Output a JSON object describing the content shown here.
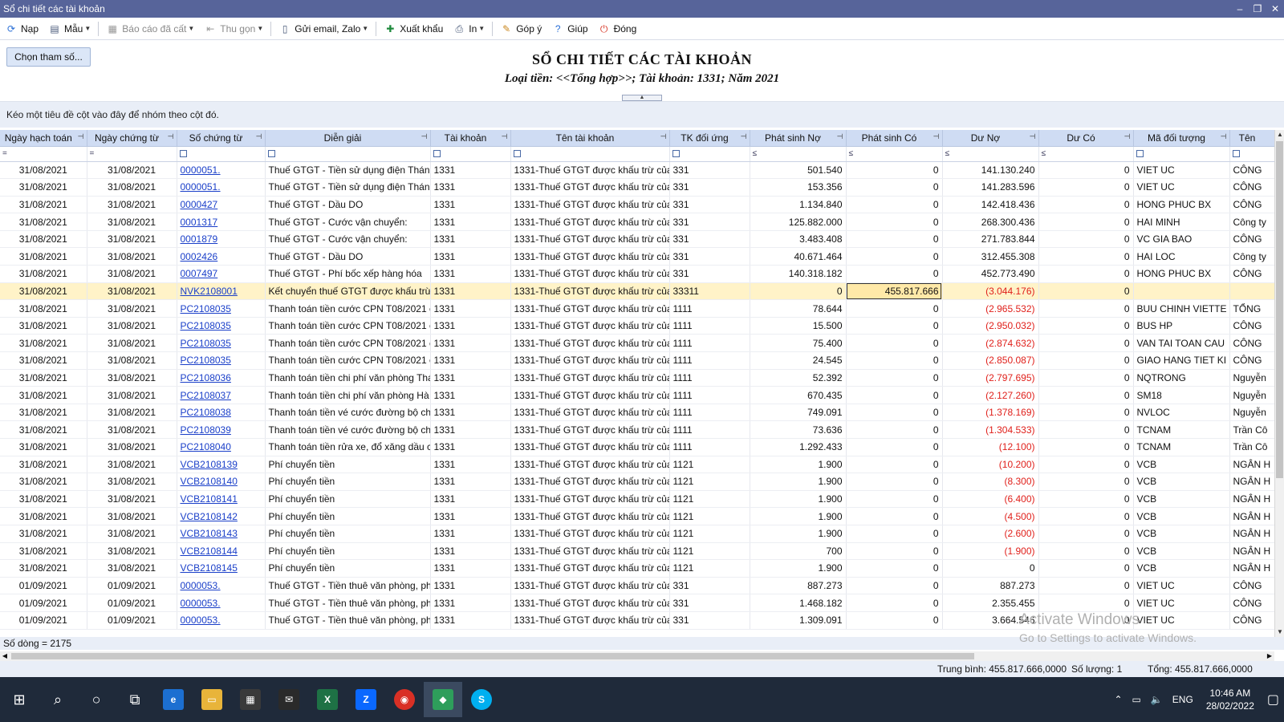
{
  "window": {
    "title": "Sổ chi tiết các tài khoản"
  },
  "toolbar": [
    {
      "label": "Nạp",
      "icon": "reload-icon",
      "dropdown": false,
      "disabled": false
    },
    {
      "label": "Mẫu",
      "icon": "template-icon",
      "dropdown": true,
      "disabled": false
    },
    {
      "label": "Báo cáo đã cất",
      "icon": "save-icon",
      "dropdown": true,
      "disabled": true
    },
    {
      "label": "Thu gọn",
      "icon": "collapse-icon",
      "dropdown": true,
      "disabled": true
    },
    {
      "label": "Gửi email, Zalo",
      "icon": "document-icon",
      "dropdown": true,
      "disabled": false
    },
    {
      "label": "Xuất khẩu",
      "icon": "excel-icon",
      "dropdown": false,
      "disabled": false
    },
    {
      "label": "In",
      "icon": "printer-icon",
      "dropdown": true,
      "disabled": false
    },
    {
      "label": "Góp ý",
      "icon": "feedback-icon",
      "dropdown": false,
      "disabled": false
    },
    {
      "label": "Giúp",
      "icon": "help-icon",
      "dropdown": false,
      "disabled": false
    },
    {
      "label": "Đóng",
      "icon": "power-icon",
      "dropdown": false,
      "disabled": false
    }
  ],
  "params_button": "Chọn tham số...",
  "report": {
    "title": "SỔ CHI TIẾT CÁC TÀI KHOẢN",
    "subtitle": "Loại tiền: <<Tổng hợp>>; Tài khoản: 1331; Năm 2021"
  },
  "group_hint": "Kéo một tiêu đề cột vào đây để nhóm theo cột đó.",
  "columns": [
    "Ngày hạch toán",
    "Ngày chứng từ",
    "Số chứng từ",
    "Diễn giải",
    "Tài khoản",
    "Tên tài khoản",
    "TK đối ứng",
    "Phát sinh Nợ",
    "Phát sinh Có",
    "Dư Nợ",
    "Dư Có",
    "Mã đối tượng",
    "Tên"
  ],
  "filters": [
    "=",
    "=",
    "□",
    "□",
    "□",
    "□",
    "□",
    "≤",
    "≤",
    "≤",
    "≤",
    "□",
    "□"
  ],
  "rows": [
    [
      "31/08/2021",
      "31/08/2021",
      "0000051.",
      "Thuế GTGT - Tiền sử dụng điện Tháng",
      "1331",
      "1331-Thuế GTGT được khấu trừ của h",
      "331",
      "501.540",
      "0",
      "141.130.240",
      "0",
      "VIET UC",
      "CÔNG"
    ],
    [
      "31/08/2021",
      "31/08/2021",
      "0000051.",
      "Thuế GTGT - Tiền sử dụng điện Tháng",
      "1331",
      "1331-Thuế GTGT được khấu trừ của h",
      "331",
      "153.356",
      "0",
      "141.283.596",
      "0",
      "VIET UC",
      "CÔNG"
    ],
    [
      "31/08/2021",
      "31/08/2021",
      "0000427",
      "Thuế GTGT - Dầu DO",
      "1331",
      "1331-Thuế GTGT được khấu trừ của h",
      "331",
      "1.134.840",
      "0",
      "142.418.436",
      "0",
      "HONG PHUC BX",
      "CÔNG"
    ],
    [
      "31/08/2021",
      "31/08/2021",
      "0001317",
      "Thuế GTGT - Cước vận chuyển:",
      "1331",
      "1331-Thuế GTGT được khấu trừ của h",
      "331",
      "125.882.000",
      "0",
      "268.300.436",
      "0",
      "HAI MINH",
      "Công ty"
    ],
    [
      "31/08/2021",
      "31/08/2021",
      "0001879",
      "Thuế GTGT - Cước vận chuyển:",
      "1331",
      "1331-Thuế GTGT được khấu trừ của h",
      "331",
      "3.483.408",
      "0",
      "271.783.844",
      "0",
      "VC GIA BAO",
      "CÔNG"
    ],
    [
      "31/08/2021",
      "31/08/2021",
      "0002426",
      "Thuế GTGT - Dầu DO",
      "1331",
      "1331-Thuế GTGT được khấu trừ của h",
      "331",
      "40.671.464",
      "0",
      "312.455.308",
      "0",
      "HAI LOC",
      "Công ty"
    ],
    [
      "31/08/2021",
      "31/08/2021",
      "0007497",
      "Thuế GTGT - Phí bốc xếp hàng hóa",
      "1331",
      "1331-Thuế GTGT được khấu trừ của h",
      "331",
      "140.318.182",
      "0",
      "452.773.490",
      "0",
      "HONG PHUC BX",
      "CÔNG"
    ],
    [
      "31/08/2021",
      "31/08/2021",
      "NVK2108001",
      "Kết chuyển thuế GTGT được khấu trừ T",
      "1331",
      "1331-Thuế GTGT được khấu trừ của h",
      "33311",
      "0",
      "455.817.666",
      "(3.044.176)",
      "0",
      "",
      ""
    ],
    [
      "31/08/2021",
      "31/08/2021",
      "PC2108035",
      "Thanh toán tiền cước CPN T08/2021 ch",
      "1331",
      "1331-Thuế GTGT được khấu trừ của h",
      "1111",
      "78.644",
      "0",
      "(2.965.532)",
      "0",
      "BUU CHINH VIETTE",
      "TỔNG"
    ],
    [
      "31/08/2021",
      "31/08/2021",
      "PC2108035",
      "Thanh toán tiền cước CPN T08/2021 ch",
      "1331",
      "1331-Thuế GTGT được khấu trừ của h",
      "1111",
      "15.500",
      "0",
      "(2.950.032)",
      "0",
      "BUS HP",
      "CÔNG"
    ],
    [
      "31/08/2021",
      "31/08/2021",
      "PC2108035",
      "Thanh toán tiền cước CPN T08/2021 ch",
      "1331",
      "1331-Thuế GTGT được khấu trừ của h",
      "1111",
      "75.400",
      "0",
      "(2.874.632)",
      "0",
      "VAN TAI TOAN CAU",
      "CÔNG"
    ],
    [
      "31/08/2021",
      "31/08/2021",
      "PC2108035",
      "Thanh toán tiền cước CPN T08/2021 ch",
      "1331",
      "1331-Thuế GTGT được khấu trừ của h",
      "1111",
      "24.545",
      "0",
      "(2.850.087)",
      "0",
      "GIAO HANG TIET KI",
      "CÔNG"
    ],
    [
      "31/08/2021",
      "31/08/2021",
      "PC2108036",
      "Thanh toán tiền chi phí văn phòng Thái",
      "1331",
      "1331-Thuế GTGT được khấu trừ của h",
      "1111",
      "52.392",
      "0",
      "(2.797.695)",
      "0",
      "NQTRONG",
      "Nguyễn"
    ],
    [
      "31/08/2021",
      "31/08/2021",
      "PC2108037",
      "Thanh toán tiền chi phí văn phòng Hà N",
      "1331",
      "1331-Thuế GTGT được khấu trừ của h",
      "1111",
      "670.435",
      "0",
      "(2.127.260)",
      "0",
      "SM18",
      "Nguyễn"
    ],
    [
      "31/08/2021",
      "31/08/2021",
      "PC2108038",
      "Thanh toán tiền vé cước đường bộ cho x",
      "1331",
      "1331-Thuế GTGT được khấu trừ của h",
      "1111",
      "749.091",
      "0",
      "(1.378.169)",
      "0",
      "NVLOC",
      "Nguyễn"
    ],
    [
      "31/08/2021",
      "31/08/2021",
      "PC2108039",
      "Thanh toán tiền vé cước đường bộ cho x",
      "1331",
      "1331-Thuế GTGT được khấu trừ của h",
      "1111",
      "73.636",
      "0",
      "(1.304.533)",
      "0",
      "TCNAM",
      "Trần Cô"
    ],
    [
      "31/08/2021",
      "31/08/2021",
      "PC2108040",
      "Thanh toán tiền rửa xe, đổ xăng dầu ch",
      "1331",
      "1331-Thuế GTGT được khấu trừ của h",
      "1111",
      "1.292.433",
      "0",
      "(12.100)",
      "0",
      "TCNAM",
      "Trần Cô"
    ],
    [
      "31/08/2021",
      "31/08/2021",
      "VCB2108139",
      "Phí chuyển tiền",
      "1331",
      "1331-Thuế GTGT được khấu trừ của h",
      "1121",
      "1.900",
      "0",
      "(10.200)",
      "0",
      "VCB",
      "NGÂN H"
    ],
    [
      "31/08/2021",
      "31/08/2021",
      "VCB2108140",
      "Phí chuyển tiền",
      "1331",
      "1331-Thuế GTGT được khấu trừ của h",
      "1121",
      "1.900",
      "0",
      "(8.300)",
      "0",
      "VCB",
      "NGÂN H"
    ],
    [
      "31/08/2021",
      "31/08/2021",
      "VCB2108141",
      "Phí chuyển tiền",
      "1331",
      "1331-Thuế GTGT được khấu trừ của h",
      "1121",
      "1.900",
      "0",
      "(6.400)",
      "0",
      "VCB",
      "NGÂN H"
    ],
    [
      "31/08/2021",
      "31/08/2021",
      "VCB2108142",
      "Phí chuyển tiền",
      "1331",
      "1331-Thuế GTGT được khấu trừ của h",
      "1121",
      "1.900",
      "0",
      "(4.500)",
      "0",
      "VCB",
      "NGÂN H"
    ],
    [
      "31/08/2021",
      "31/08/2021",
      "VCB2108143",
      "Phí chuyển tiền",
      "1331",
      "1331-Thuế GTGT được khấu trừ của h",
      "1121",
      "1.900",
      "0",
      "(2.600)",
      "0",
      "VCB",
      "NGÂN H"
    ],
    [
      "31/08/2021",
      "31/08/2021",
      "VCB2108144",
      "Phí chuyển tiền",
      "1331",
      "1331-Thuế GTGT được khấu trừ của h",
      "1121",
      "700",
      "0",
      "(1.900)",
      "0",
      "VCB",
      "NGÂN H"
    ],
    [
      "31/08/2021",
      "31/08/2021",
      "VCB2108145",
      "Phí chuyển tiền",
      "1331",
      "1331-Thuế GTGT được khấu trừ của h",
      "1121",
      "1.900",
      "0",
      "0",
      "0",
      "VCB",
      "NGÂN H"
    ],
    [
      "01/09/2021",
      "01/09/2021",
      "0000053.",
      "Thuế GTGT - Tiền thuê văn phòng, phí",
      "1331",
      "1331-Thuế GTGT được khấu trừ của h",
      "331",
      "887.273",
      "0",
      "887.273",
      "0",
      "VIET UC",
      "CÔNG"
    ],
    [
      "01/09/2021",
      "01/09/2021",
      "0000053.",
      "Thuế GTGT - Tiền thuê văn phòng, phí",
      "1331",
      "1331-Thuế GTGT được khấu trừ của h",
      "331",
      "1.468.182",
      "0",
      "2.355.455",
      "0",
      "VIET UC",
      "CÔNG"
    ],
    [
      "01/09/2021",
      "01/09/2021",
      "0000053.",
      "Thuế GTGT - Tiền thuê văn phòng, phí",
      "1331",
      "1331-Thuế GTGT được khấu trừ của h",
      "331",
      "1.309.091",
      "0",
      "3.664.546",
      "0",
      "VIET UC",
      "CÔNG"
    ]
  ],
  "selected_row": 7,
  "row_count": "Số dòng = 2175",
  "summary": {
    "average": "Trung bình: 455.817.666,0000",
    "count": "Số lượng: 1",
    "total": "Tổng: 455.817.666,0000"
  },
  "watermark": {
    "line1": "Activate Windows",
    "line2": "Go to Settings to activate Windows."
  },
  "taskbar": {
    "apps": [
      "start-icon",
      "search-icon",
      "cortana-icon",
      "task-view-icon",
      "edge-icon",
      "explorer-icon",
      "store-icon",
      "mail-icon",
      "excel-icon",
      "zalo-icon",
      "chrome-icon",
      "misa-icon",
      "skype-icon"
    ],
    "language": "ENG",
    "time": "10:46 AM",
    "date": "28/02/2022"
  },
  "colors": {
    "titlebar": "#57649a",
    "header": "#cfdcf3",
    "selected_row": "#fff3c8",
    "negative": "#e0201b",
    "link": "#1a3fc9",
    "taskbar": "#1f2a3a"
  }
}
